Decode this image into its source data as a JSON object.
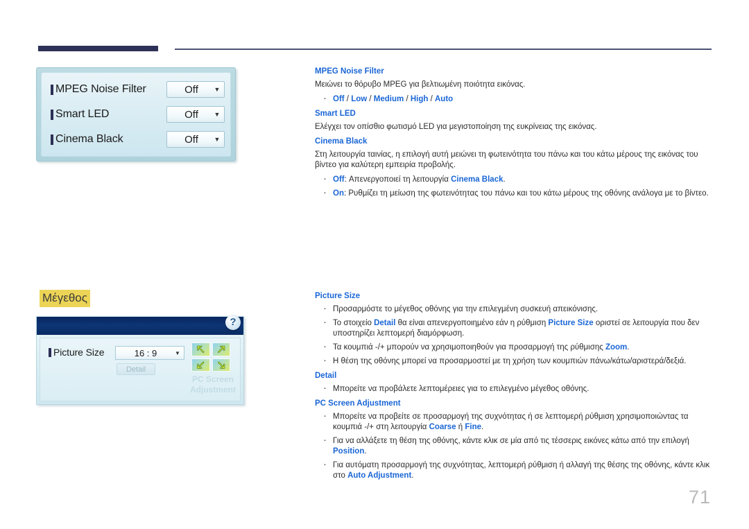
{
  "page": {
    "number": "71",
    "accent_blue": "#1a66d6",
    "rule_dark": "#2e3157",
    "highlight_yellow": "#ecd456"
  },
  "mockup_picture_menu": {
    "rows": [
      {
        "label": "MPEG Noise Filter",
        "value": "Off"
      },
      {
        "label": "Smart LED",
        "value": "Off"
      },
      {
        "label": "Cinema Black",
        "value": "Off"
      }
    ]
  },
  "section_heading": "Μέγεθος",
  "mockup_picture_size": {
    "help_icon": "?",
    "row_label": "Picture Size",
    "row_value": "16 : 9",
    "detail_button": "Detail",
    "pc_screen_label_line1": "PC Screen",
    "pc_screen_label_line2": "Adjustment"
  },
  "content": {
    "mpeg_noise_filter": {
      "title": "MPEG Noise Filter",
      "text": "Μειώνει το θόρυβο MPEG για βελτιωμένη ποιότητα εικόνας.",
      "options": [
        "Off",
        "Low",
        "Medium",
        "High",
        "Auto"
      ],
      "option_separator": " / "
    },
    "smart_led": {
      "title": "Smart LED",
      "text": "Ελέγχει τον οπίσθιο φωτισμό LED για μεγιστοποίηση της ευκρίνειας της εικόνας."
    },
    "cinema_black": {
      "title": "Cinema Black",
      "text": "Στη λειτουργία ταινίας, η επιλογή αυτή μειώνει τη φωτεινότητα του πάνω και του κάτω μέρους της εικόνας του βίντεο για καλύτερη εμπειρία προβολής.",
      "bullet_off_kw": "Off",
      "bullet_off_mid": ": Απενεργοποιεί τη λειτουργία ",
      "bullet_off_kw2": "Cinema Black",
      "bullet_off_end": ".",
      "bullet_on_kw": "On",
      "bullet_on_text": ": Ρυθμίζει τη μείωση της φωτεινότητας του πάνω και του κάτω μέρους της οθόνης ανάλογα με το βίντεο."
    },
    "picture_size": {
      "title": "Picture Size",
      "b1": "Προσαρμόστε το μέγεθος οθόνης για την επιλεγμένη συσκευή απεικόνισης.",
      "b2_pre": "Το στοιχείο ",
      "b2_kw1": "Detail",
      "b2_mid": " θα είναι απενεργοποιημένο εάν η ρύθμιση ",
      "b2_kw2": "Picture Size",
      "b2_end": " οριστεί σε λειτουργία που δεν υποστηρίζει λεπτομερή διαμόρφωση.",
      "b3_pre": "Τα κουμπιά -/+ μπορούν να χρησιμοποιηθούν για προσαρμογή της ρύθμισης ",
      "b3_kw": "Zoom",
      "b3_end": ".",
      "b4": "Η θέση της οθόνης μπορεί να προσαρμοστεί με τη χρήση των κουμπιών πάνω/κάτω/αριστερά/δεξιά."
    },
    "detail": {
      "title": "Detail",
      "b1": "Μπορείτε να προβάλετε λεπτομέρειες για το επιλεγμένο μέγεθος οθόνης."
    },
    "pc_screen_adjustment": {
      "title": "PC Screen Adjustment",
      "b1_pre": "Μπορείτε να προβείτε σε προσαρμογή της συχνότητας ή σε λεπτομερή ρύθμιση χρησιμοποιώντας τα κουμπιά -/+ στη λειτουργία ",
      "b1_kw1": "Coarse",
      "b1_mid": " ή ",
      "b1_kw2": "Fine",
      "b1_end": ".",
      "b2_pre": "Για να αλλάξετε τη θέση της οθόνης, κάντε κλικ σε μία από τις τέσσερις εικόνες κάτω από την επιλογή ",
      "b2_kw": "Position",
      "b2_end": ".",
      "b3_pre": "Για αυτόματη προσαρμογή της συχνότητας, λεπτομερή ρύθμιση ή αλλαγή της θέσης της οθόνης, κάντε κλικ στο ",
      "b3_kw": "Auto Adjustment",
      "b3_end": "."
    }
  }
}
